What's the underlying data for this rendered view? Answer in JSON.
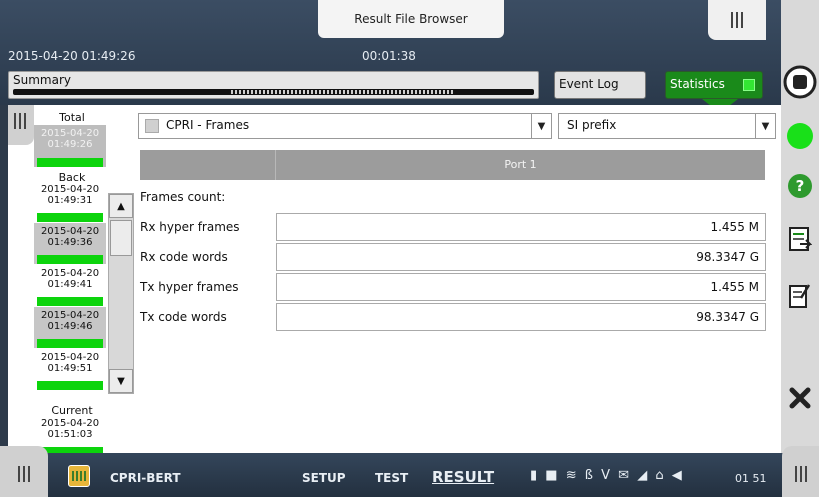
{
  "header": {
    "window_title": "Result File Browser",
    "datetime": "2015-04-20 01:49:26",
    "elapsed": "00:01:38"
  },
  "toolbar": {
    "summary_label": "Summary",
    "event_log_label": "Event Log",
    "statistics_label": "Statistics"
  },
  "history": {
    "total_label": "Total",
    "total_entry": {
      "date": "2015-04-20",
      "time": "01:49:26"
    },
    "back_label": "Back",
    "entries": [
      {
        "date": "2015-04-20",
        "time": "01:49:31"
      },
      {
        "date": "2015-04-20",
        "time": "01:49:36"
      },
      {
        "date": "2015-04-20",
        "time": "01:49:41"
      },
      {
        "date": "2015-04-20",
        "time": "01:49:46"
      },
      {
        "date": "2015-04-20",
        "time": "01:49:51"
      }
    ],
    "current_label": "Current",
    "current_entry": {
      "date": "2015-04-20",
      "time": "01:51:03"
    }
  },
  "selectors": {
    "frames_value": "CPRI - Frames",
    "prefix_value": "SI prefix"
  },
  "table": {
    "port_header": "Port 1",
    "section_label": "Frames count:",
    "rows": [
      {
        "label": "Rx hyper frames",
        "value": "1.455 M"
      },
      {
        "label": "Rx code words",
        "value": "98.3347 G"
      },
      {
        "label": "Tx hyper frames",
        "value": "1.455 M"
      },
      {
        "label": "Tx code words",
        "value": "98.3347 G"
      }
    ]
  },
  "bottom": {
    "app_name": "CPRI-BERT",
    "nav_setup": "SETUP",
    "nav_test": "TEST",
    "nav_result": "RESULT",
    "clock": "01 51"
  },
  "colors": {
    "accent_green": "#1a8a1a",
    "led_green": "#0cd40c",
    "header_bg": "#2d3a4a"
  }
}
